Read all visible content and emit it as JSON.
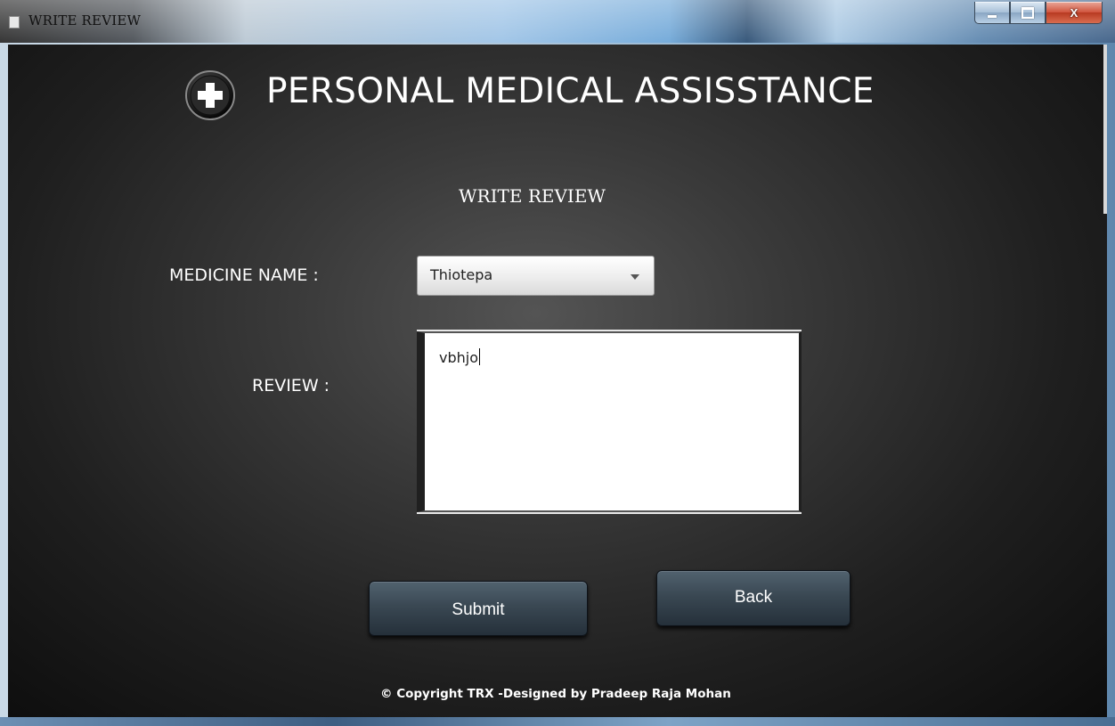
{
  "window": {
    "title": "WRITE REVIEW",
    "controls": {
      "minimize_icon": "minimize-icon",
      "maximize_icon": "maximize-icon",
      "close_label": "X"
    }
  },
  "header": {
    "logo_icon": "medical-cross-icon",
    "app_title": "PERSONAL MEDICAL ASSISSTANCE"
  },
  "form": {
    "section_title": "WRITE REVIEW",
    "medicine_label": "MEDICINE NAME :",
    "medicine_selected": "Thiotepa",
    "review_label": "REVIEW :",
    "review_value": "vbhjo",
    "submit_label": "Submit",
    "back_label": "Back"
  },
  "footer": {
    "copyright": "© Copyright TRX -Designed by Pradeep Raja Mohan"
  },
  "colors": {
    "background": "#1f1f1f",
    "button": "#3a4853",
    "text": "#ffffff"
  }
}
